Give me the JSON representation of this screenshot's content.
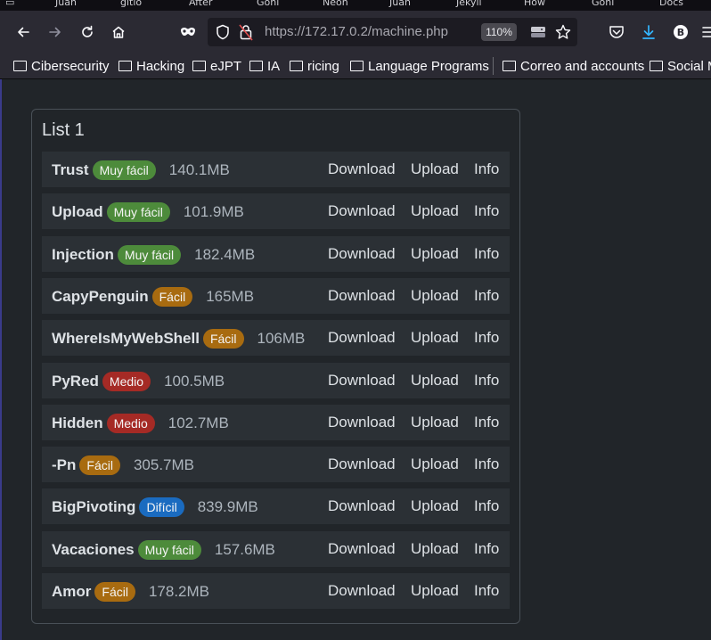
{
  "browser": {
    "tabs": [
      "Juan",
      "gitio",
      "After",
      "Goni",
      "Neon",
      "Juan",
      "Jekyll",
      "How",
      "Goni",
      "Docs"
    ],
    "url": "https://172.17.0.2/machine.php",
    "zoom": "110%",
    "bookmarks": [
      "Cibersecurity",
      "Hacking",
      "eJPT",
      "IA",
      "ricing",
      "Language Programs",
      "Correo and accounts",
      "Social M"
    ]
  },
  "list": {
    "title": "List 1",
    "actions": {
      "download": "Download",
      "upload": "Upload",
      "info": "Info"
    },
    "machines": [
      {
        "name": "Trust",
        "difficulty": "Muy fácil",
        "size": "140.1MB"
      },
      {
        "name": "Upload",
        "difficulty": "Muy fácil",
        "size": "101.9MB"
      },
      {
        "name": "Injection",
        "difficulty": "Muy fácil",
        "size": "182.4MB"
      },
      {
        "name": "CapyPenguin",
        "difficulty": "Fácil",
        "size": "165MB"
      },
      {
        "name": "WhereIsMyWebShell",
        "difficulty": "Fácil",
        "size": "106MB"
      },
      {
        "name": "PyRed",
        "difficulty": "Medio",
        "size": "100.5MB"
      },
      {
        "name": "Hidden",
        "difficulty": "Medio",
        "size": "102.7MB"
      },
      {
        "name": "-Pn",
        "difficulty": "Fácil",
        "size": "305.7MB"
      },
      {
        "name": "BigPivoting",
        "difficulty": "Difícil",
        "size": "839.9MB"
      },
      {
        "name": "Vacaciones",
        "difficulty": "Muy fácil",
        "size": "157.6MB"
      },
      {
        "name": "Amor",
        "difficulty": "Fácil",
        "size": "178.2MB"
      }
    ]
  },
  "colors": {
    "muy_facil": "#4d8b3b",
    "facil": "#a86b10",
    "medio": "#a52a25",
    "dificil": "#1a6bc0"
  }
}
